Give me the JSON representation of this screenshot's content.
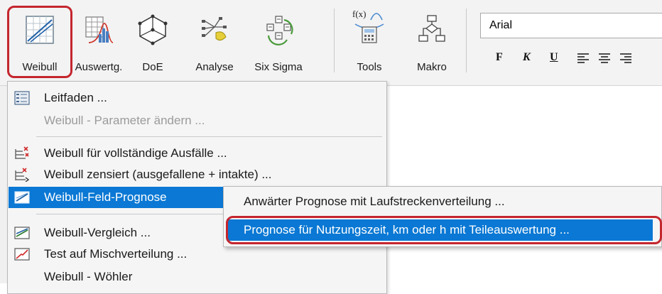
{
  "ribbon": {
    "buttons": [
      {
        "label": "Weibull",
        "icon": "weibull-chart-icon"
      },
      {
        "label": "Auswertg.",
        "icon": "distribution-icon"
      },
      {
        "label": "DoE",
        "icon": "doe-cube-icon"
      },
      {
        "label": "Analyse",
        "icon": "analysis-icon"
      },
      {
        "label": "Six Sigma",
        "icon": "six-sigma-icon"
      },
      {
        "label": "Tools",
        "icon": "function-tools-icon"
      },
      {
        "label": "Makro",
        "icon": "macro-flowchart-icon"
      }
    ],
    "tools_icon_text": "f(x)",
    "font_name": "Arial",
    "format": {
      "bold": "F",
      "italic": "K",
      "underline": "U"
    },
    "align_icons": [
      "align-left-icon",
      "align-center-icon",
      "align-right-icon"
    ]
  },
  "menu": {
    "items": [
      {
        "label": "Leitfaden ...",
        "icon": "guide-icon",
        "enabled": true
      },
      {
        "label": "Weibull - Parameter ändern ...",
        "enabled": false
      },
      {
        "label": "Weibull für vollständige Ausfälle ...",
        "icon": "complete-failures-icon",
        "enabled": true
      },
      {
        "label": "Weibull zensiert (ausgefallene + intakte) ...",
        "icon": "censored-icon",
        "enabled": true
      },
      {
        "label": "Weibull-Feld-Prognose",
        "icon": "field-forecast-icon",
        "enabled": true,
        "highlighted": true
      },
      {
        "label": "Weibull-Vergleich ...",
        "icon": "comparison-icon",
        "enabled": true
      },
      {
        "label": "Test auf Mischverteilung ...",
        "icon": "mixed-distribution-icon",
        "enabled": true
      },
      {
        "label": "Weibull - Wöhler",
        "enabled": true
      }
    ]
  },
  "submenu": {
    "items": [
      {
        "label": "Anwärter Prognose mit Laufstreckenverteilung ..."
      },
      {
        "label": "Prognose für Nutzungszeit, km oder h mit Teileauswertung ...",
        "highlighted": true
      }
    ]
  },
  "colors": {
    "highlight": "#0a78d4",
    "annotation": "#c4262e"
  }
}
